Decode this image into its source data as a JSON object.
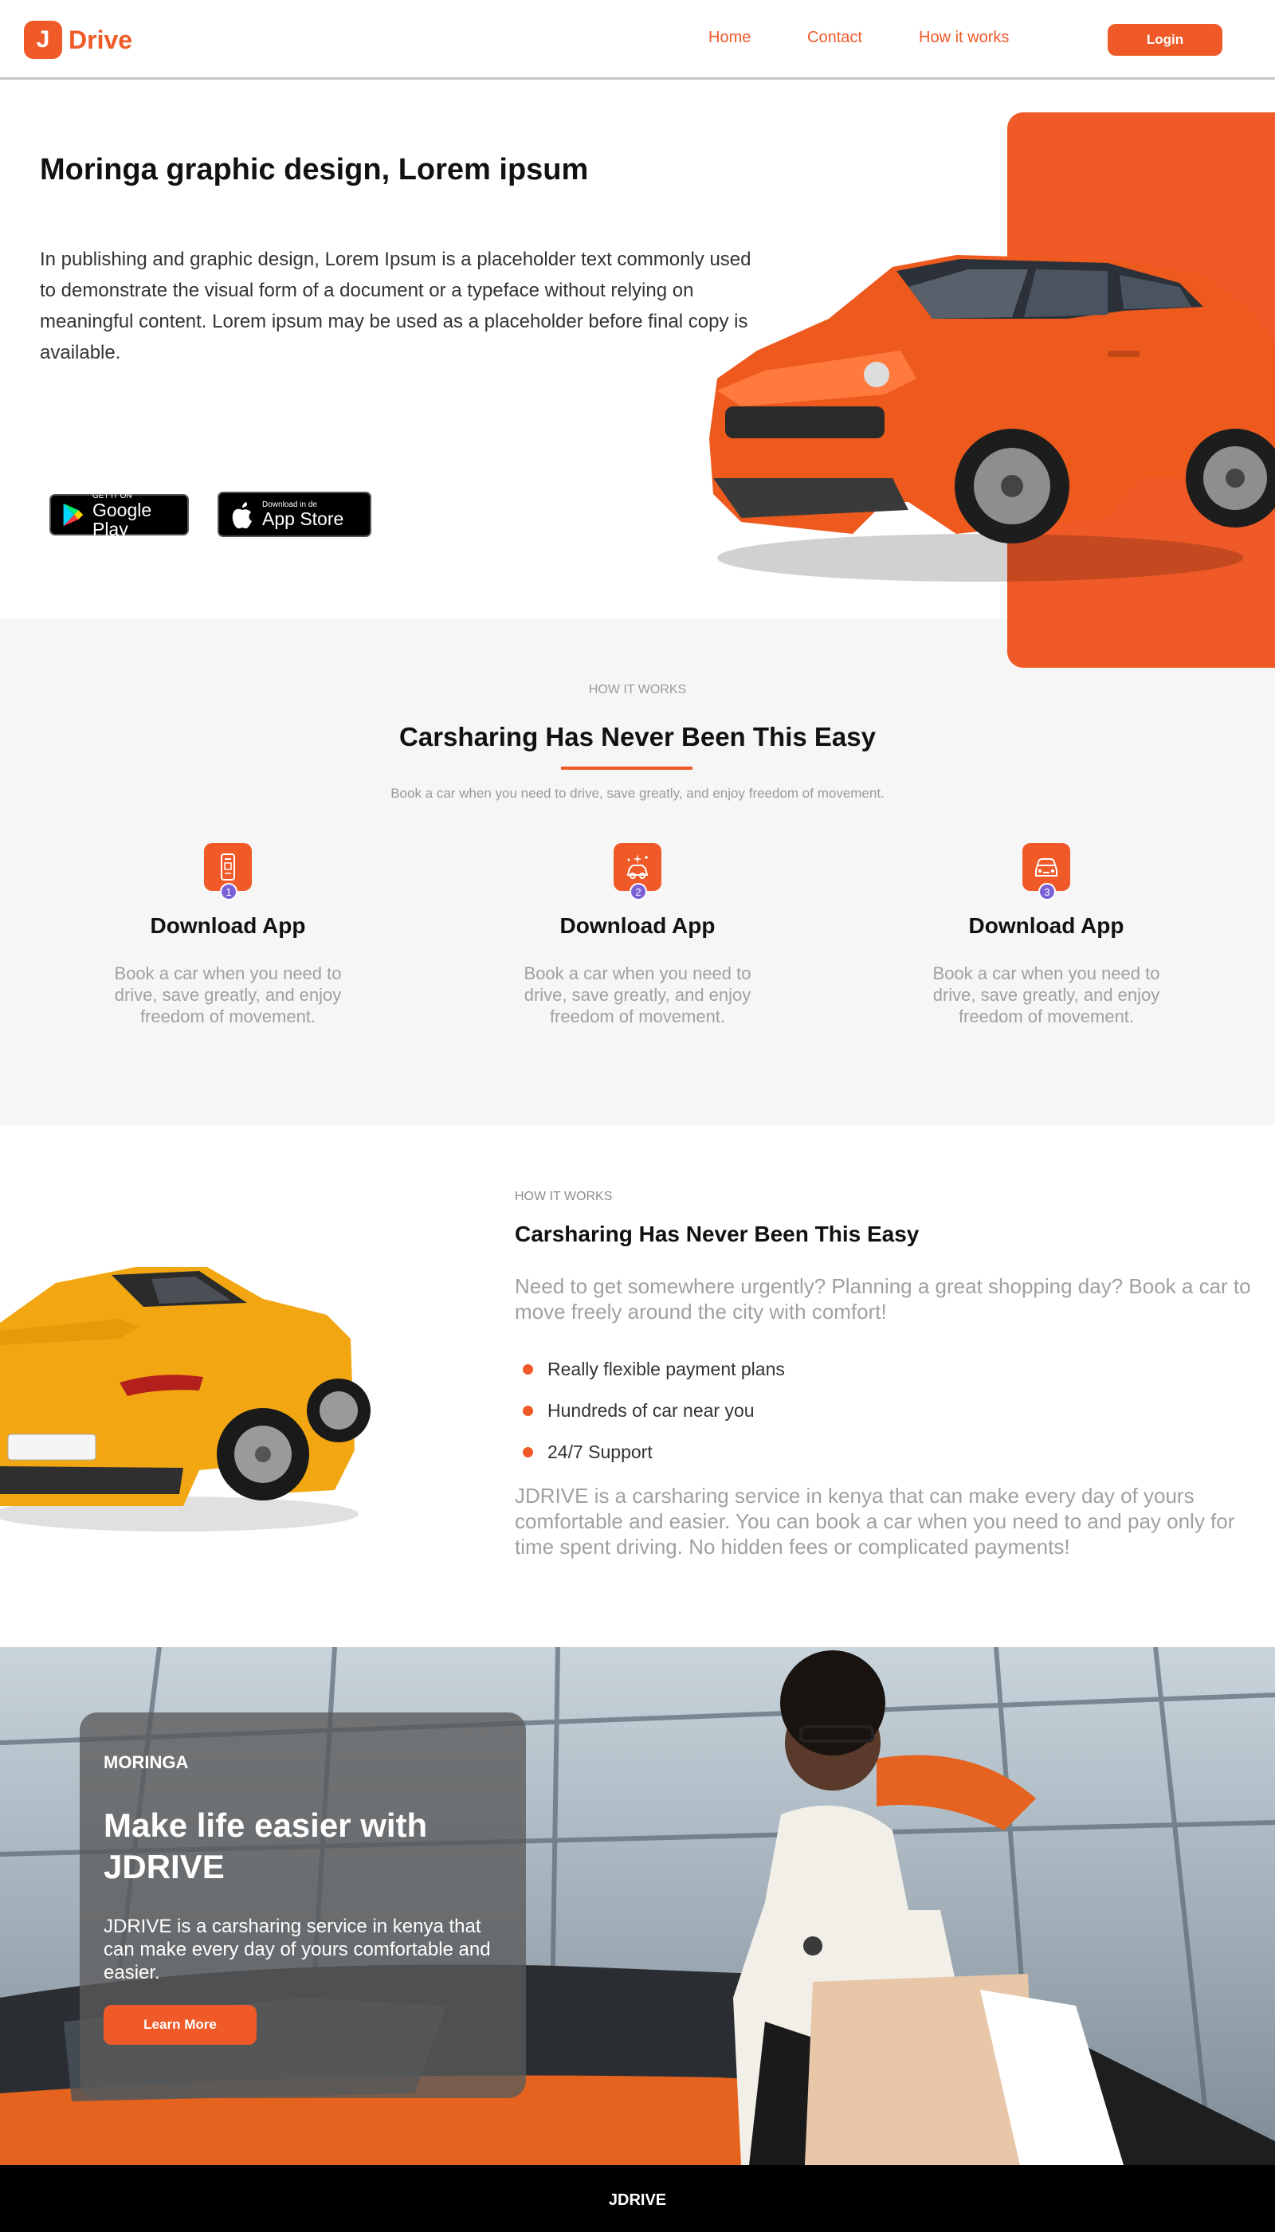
{
  "nav": {
    "logo_letter": "J",
    "logo_text": "Drive",
    "links": [
      "Home",
      "Contact",
      "How it works"
    ],
    "login_label": "Login"
  },
  "hero": {
    "title": "Moringa graphic design, Lorem ipsum",
    "text": "In publishing and graphic design, Lorem Ipsum is a placeholder text commonly used to demonstrate the visual form of a document or a typeface without relying on meaningful content. Lorem ipsum may be used as a placeholder before final copy is available.",
    "google_play": {
      "small": "GET IT ON",
      "big": "Google Play"
    },
    "app_store": {
      "small": "Download in de",
      "big": "App Store"
    }
  },
  "how": {
    "eyebrow": "HOW IT WORKS",
    "title": "Carsharing Has Never Been This Easy",
    "subtitle": "Book a car when you need to drive, save greatly, and enjoy freedom of movement.",
    "steps": [
      {
        "num": "1",
        "title": "Download App",
        "text": "Book a car when you need to drive, save greatly, and enjoy freedom of movement.",
        "icon": "phone-app-icon"
      },
      {
        "num": "2",
        "title": "Download App",
        "text": "Book a car when you need to drive, save greatly, and enjoy freedom of movement.",
        "icon": "sparkle-car-icon"
      },
      {
        "num": "3",
        "title": "Download App",
        "text": "Book a car when you need to drive, save greatly, and enjoy freedom of movement.",
        "icon": "car-front-icon"
      }
    ]
  },
  "feature": {
    "eyebrow": "HOW IT WORKS",
    "title": "Carsharing Has Never Been This Easy",
    "intro": "Need to get somewhere urgently? Planning a great shopping day? Book a car to move freely around the city with comfort!",
    "bullets": [
      "Really flexible payment plans",
      "Hundreds of car near you",
      "24/7 Support"
    ],
    "outro": "JDRIVE is a carsharing service in kenya that can make every day of yours comfortable and easier. You can book a car when you need to and pay only for time spent driving. No hidden fees or complicated payments!"
  },
  "promo": {
    "eyebrow": "MORINGA",
    "title": "Make life easier with JDRIVE",
    "text": "JDRIVE is a carsharing service in kenya that can make every day of yours comfortable and easier.",
    "button": "Learn More"
  },
  "footer": {
    "text": "JDRIVE"
  },
  "colors": {
    "accent": "#ef5a28",
    "step_badge": "#7a62d6",
    "footer_bg": "#000000",
    "section_bg": "#f6f6f6"
  }
}
